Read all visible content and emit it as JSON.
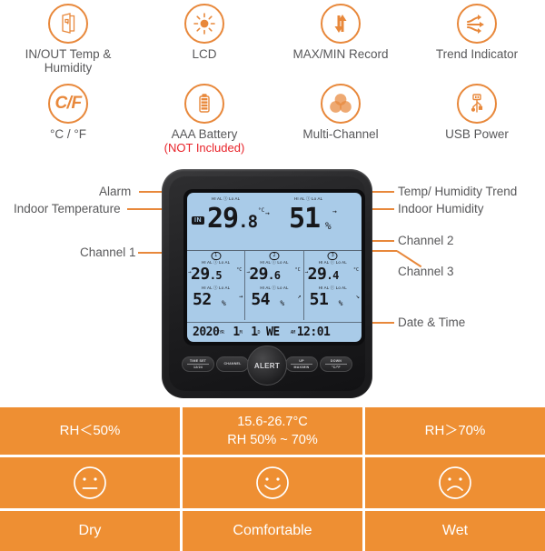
{
  "features": [
    {
      "icon": "door-icon",
      "label": "IN/OUT Temp &\nHumidity",
      "note": ""
    },
    {
      "icon": "sun-icon",
      "label": "LCD",
      "note": ""
    },
    {
      "icon": "up-down-arrows-icon",
      "label": "MAX/MIN Record",
      "note": ""
    },
    {
      "icon": "trend-arrows-icon",
      "label": "Trend Indicator",
      "note": ""
    },
    {
      "icon": "celsius-fahrenheit-icon",
      "label": "°C / °F",
      "note": "",
      "glyph": "C/F"
    },
    {
      "icon": "battery-icon",
      "label": "AAA Battery",
      "note": "(NOT Included)"
    },
    {
      "icon": "multi-channel-icon",
      "label": "Multi-Channel",
      "note": ""
    },
    {
      "icon": "usb-icon",
      "label": "USB Power",
      "note": ""
    }
  ],
  "device": {
    "lcd": {
      "main": {
        "source_badge": "IN",
        "alarm_left": "HI AL ⓘ Lo AL",
        "alarm_right": "HI AL ⓘ Lo AL",
        "temperature": "29",
        "temperature_decimal": ".8",
        "temperature_unit": "°C",
        "temperature_trend": "→",
        "humidity": "51",
        "humidity_unit": "%",
        "humidity_trend": "→"
      },
      "channels": [
        {
          "number": "1",
          "alarm_temp": "HI AL ⓘ Lo AL",
          "temperature": "29",
          "temperature_decimal": ".5",
          "temperature_unit": "°C",
          "temperature_trend": "→",
          "alarm_hum": "HI AL ⓘ Lo AL",
          "humidity": "52",
          "humidity_unit": "%",
          "humidity_trend": "→"
        },
        {
          "number": "2",
          "alarm_temp": "HI AL ⓘ Lo AL",
          "temperature": "29",
          "temperature_decimal": ".6",
          "temperature_unit": "°C",
          "temperature_trend": "→",
          "alarm_hum": "HI AL ⓘ Lo AL",
          "humidity": "54",
          "humidity_unit": "%",
          "humidity_trend": "↗"
        },
        {
          "number": "3",
          "alarm_temp": "HI AL ⓘ Lo AL",
          "temperature": "29",
          "temperature_decimal": ".4",
          "temperature_unit": "°C",
          "temperature_trend": "→",
          "alarm_hum": "HI AL ⓘ Lo AL",
          "humidity": "51",
          "humidity_unit": "%",
          "humidity_trend": "↘"
        }
      ],
      "datebar": {
        "year": "2020",
        "year_unit": "YR",
        "month": "1",
        "month_unit": "M",
        "day": "1",
        "day_unit": "D",
        "weekday": "WE",
        "meridiem": "AM",
        "time": "12:01"
      }
    },
    "buttons": [
      {
        "name": "time-set-button",
        "line1": "TIME SET",
        "line2": "12/24"
      },
      {
        "name": "channel-button",
        "line1": "CHANNEL",
        "line2": ""
      },
      {
        "name": "alert-button",
        "line1": "ALERT",
        "line2": ""
      },
      {
        "name": "up-button",
        "line1": "UP",
        "line2": "MAX/MIN"
      },
      {
        "name": "down-button",
        "line1": "DOWN",
        "line2": "°C/°F"
      }
    ]
  },
  "callouts": {
    "left": [
      {
        "label": "Alarm"
      },
      {
        "label": "Indoor Temperature"
      },
      {
        "label": "Channel 1"
      }
    ],
    "right": [
      {
        "label": "Temp/ Humidity Trend"
      },
      {
        "label": "Indoor Humidity"
      },
      {
        "label": "Channel 2"
      },
      {
        "label": "Channel 3"
      },
      {
        "label": "Date & Time"
      }
    ]
  },
  "comfort_table": {
    "ranges": [
      {
        "line1": "RH＜50%",
        "line2": ""
      },
      {
        "line1": "15.6-26.7°C",
        "line2": "RH 50% ~ 70%"
      },
      {
        "line1": "RH＞70%",
        "line2": ""
      }
    ],
    "faces": [
      "neutral-face",
      "smile-face",
      "sad-face"
    ],
    "labels": [
      "Dry",
      "Comfortable",
      "Wet"
    ]
  },
  "colors": {
    "accent_orange": "#EE8F33",
    "icon_orange": "#E8883B",
    "alert_red": "#E8232A",
    "lcd_blue": "#A9CBE8",
    "device_black": "#232325",
    "text_gray": "#58585A"
  }
}
